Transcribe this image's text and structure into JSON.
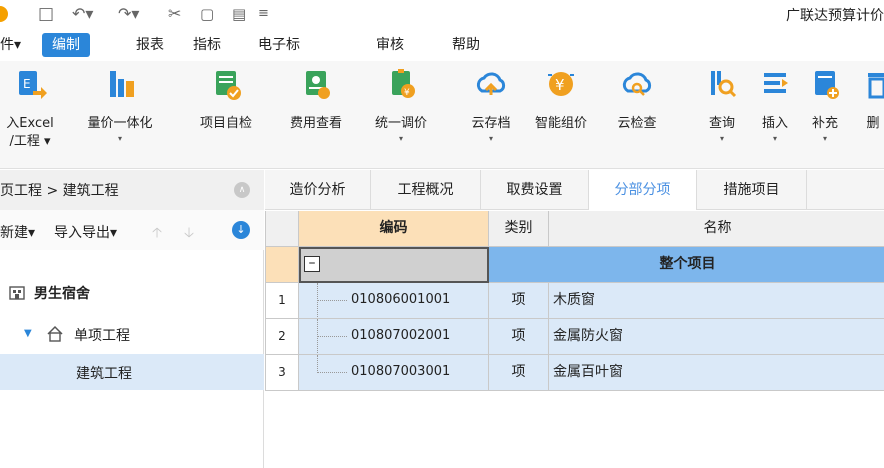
{
  "titlebar": {
    "app_title": "广联达预算计价",
    "undo_icon": "undo-icon",
    "redo_icon": "redo-icon",
    "save_icon": "save-icon",
    "cut_icon": "cut-icon"
  },
  "menu": {
    "items": [
      "件▾",
      "编制",
      "报表",
      "指标",
      "电子标",
      "审核",
      "帮助"
    ]
  },
  "ribbon": {
    "buttons": [
      {
        "label1": "入Excel",
        "label2": "/工程 ▾",
        "icon": "import-excel-icon",
        "color": "#2b86d9"
      },
      {
        "label1": "量价一体化",
        "label2": "▾",
        "icon": "volume-price-icon",
        "color": "#2b86d9"
      },
      {
        "label1": "项目自检",
        "label2": "",
        "icon": "project-check-icon",
        "color": "#3aa35b"
      },
      {
        "label1": "费用查看",
        "label2": "",
        "icon": "fee-view-icon",
        "color": "#3aa35b"
      },
      {
        "label1": "统一调价",
        "label2": "▾",
        "icon": "unified-price-icon",
        "color": "#3aa35b"
      },
      {
        "label1": "云存档",
        "label2": "▾",
        "icon": "cloud-save-icon",
        "color": "#2b86d9"
      },
      {
        "label1": "智能组价",
        "label2": "",
        "icon": "smart-price-icon",
        "color": "#f0a020"
      },
      {
        "label1": "云检查",
        "label2": "",
        "icon": "cloud-check-icon",
        "color": "#2b86d9"
      },
      {
        "label1": "查询",
        "label2": "▾",
        "icon": "query-icon",
        "color": "#2b86d9"
      },
      {
        "label1": "插入",
        "label2": "▾",
        "icon": "insert-icon",
        "color": "#2b86d9"
      },
      {
        "label1": "补充",
        "label2": "▾",
        "icon": "supplement-icon",
        "color": "#2b86d9"
      },
      {
        "label1": "删",
        "label2": "",
        "icon": "delete-icon",
        "color": "#2b86d9"
      }
    ]
  },
  "left_panel": {
    "path": "页工程 > 建筑工程",
    "tools": [
      "新建▾",
      "导入导出▾"
    ],
    "tree": [
      {
        "label": "男生宿舍",
        "icon": "building-icon"
      },
      {
        "label": "单项工程",
        "icon": "home-icon"
      },
      {
        "label": "建筑工程",
        "icon": ""
      }
    ]
  },
  "tabs": [
    "造价分析",
    "工程概况",
    "取费设置",
    "分部分项",
    "措施项目"
  ],
  "grid": {
    "headers": [
      "编码",
      "类别",
      "名称"
    ],
    "top_row": {
      "label": "整个项目"
    },
    "rows": [
      {
        "num": "1",
        "code": "010806001001",
        "type": "项",
        "name": "木质窗"
      },
      {
        "num": "2",
        "code": "010807002001",
        "type": "项",
        "name": "金属防火窗"
      },
      {
        "num": "3",
        "code": "010807003001",
        "type": "项",
        "name": "金属百叶窗"
      }
    ]
  },
  "colors": {
    "accent": "#2b86d9",
    "selected_row": "#dbe9f8",
    "top_row": "#7db6ec",
    "header_selected": "#fce0b8"
  }
}
